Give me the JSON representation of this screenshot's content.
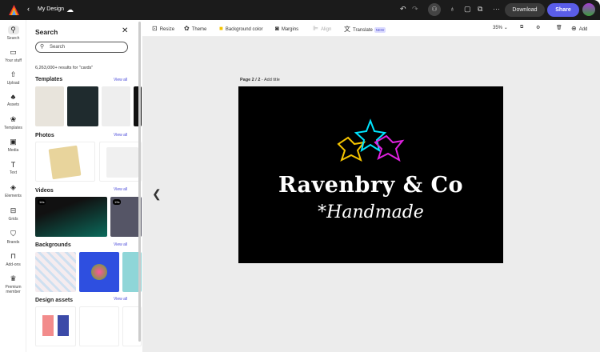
{
  "topbar": {
    "title": "My Design",
    "undo": "undo-icon",
    "redo": "redo-icon",
    "download": "Download",
    "share": "Share"
  },
  "rail": [
    {
      "label": "Search",
      "icon": "search-icon"
    },
    {
      "label": "Your stuff",
      "icon": "folder-icon"
    },
    {
      "label": "Upload",
      "icon": "upload-icon"
    },
    {
      "label": "Assets",
      "icon": "assets-icon"
    },
    {
      "label": "Templates",
      "icon": "templates-icon"
    },
    {
      "label": "Media",
      "icon": "media-icon"
    },
    {
      "label": "Text",
      "icon": "text-icon"
    },
    {
      "label": "Elements",
      "icon": "elements-icon"
    },
    {
      "label": "Grids",
      "icon": "grids-icon"
    },
    {
      "label": "Brands",
      "icon": "brands-icon"
    },
    {
      "label": "Add-ons",
      "icon": "addons-icon"
    },
    {
      "label": "Premium member",
      "icon": "premium-icon"
    }
  ],
  "panel": {
    "title": "Search",
    "search_placeholder": "Search",
    "results": "6,263,000+ results for \"cards\"",
    "view_all": "View all",
    "sections": [
      "Templates",
      "Photos",
      "Videos",
      "Backgrounds",
      "Design assets"
    ],
    "videos": [
      "14s",
      "19s"
    ]
  },
  "toolbar": {
    "resize": "Resize",
    "theme": "Theme",
    "background_color": "Background color",
    "margins": "Margins",
    "align": "Align",
    "translate": "Translate",
    "new_badge": "NEW",
    "zoom": "35%",
    "add": "Add"
  },
  "canvas": {
    "page_label": "Page 2 / 2",
    "add_title": " - Add title",
    "brand": "Ravenbry & Co",
    "tagline": "*Handmade"
  },
  "colors": {
    "share": "#5a5de8",
    "accent_link": "#4b4bd9",
    "star_yellow": "#f5c400",
    "star_cyan": "#00e5ff",
    "star_magenta": "#e020e0"
  }
}
